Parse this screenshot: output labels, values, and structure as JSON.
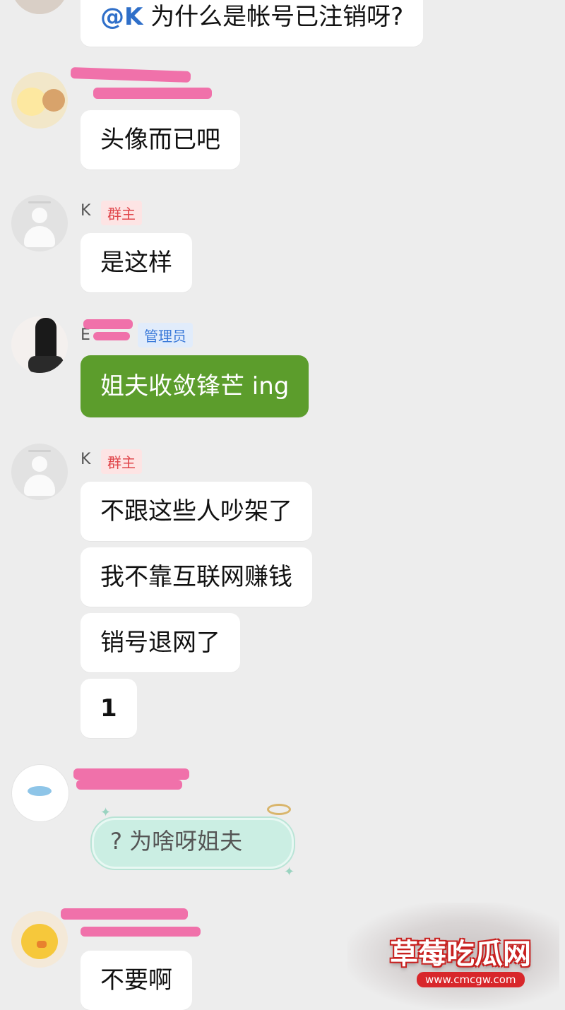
{
  "messages": [
    {
      "id": "m0",
      "text_mention": "@K",
      "text": " 为什么是帐号已注销呀?"
    },
    {
      "id": "m1",
      "text": "头像而已吧"
    },
    {
      "id": "m2",
      "sender": "K",
      "badge": "群主",
      "text": "是这样"
    },
    {
      "id": "m3",
      "sender": "E",
      "badge": "管理员",
      "text": "姐夫收敛锋芒 ing"
    },
    {
      "id": "m4",
      "sender": "K",
      "badge": "群主",
      "texts": [
        "不跟这些人吵架了",
        "我不靠互联网赚钱",
        "销号退网了",
        "1"
      ]
    },
    {
      "id": "m5",
      "sticker_text": "? 为啥呀姐夫"
    },
    {
      "id": "m6",
      "text": "不要啊"
    }
  ],
  "watermark": {
    "title": "草莓吃瓜网",
    "url": "www.cmcgw.com"
  },
  "colors": {
    "background": "#ededed",
    "bubble": "#ffffff",
    "green_bubble": "#5c9d2c",
    "redaction": "#f06aa6",
    "owner_badge": "#e0454a",
    "admin_badge": "#3b7ad9"
  }
}
